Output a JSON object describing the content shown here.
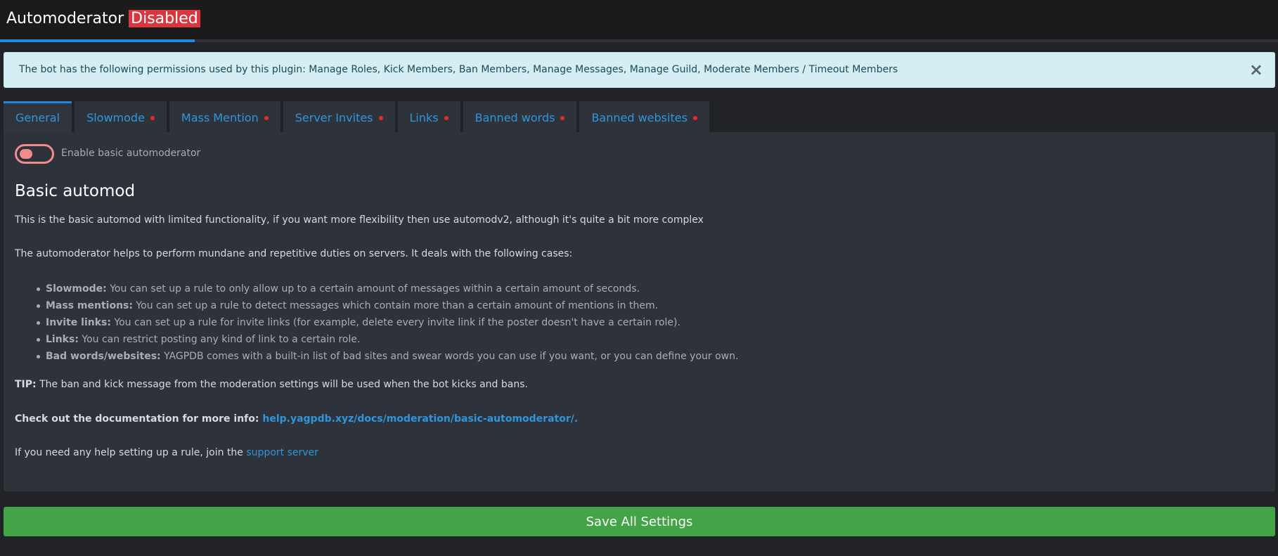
{
  "header": {
    "title": "Automoderator",
    "status": "Disabled"
  },
  "alert": {
    "text": "The bot has the following permissions used by this plugin: Manage Roles, Kick Members, Ban Members, Manage Messages, Manage Guild, Moderate Members / Timeout Members",
    "close_label": "×"
  },
  "tabs": [
    {
      "label": "General",
      "active": true,
      "dot": false
    },
    {
      "label": "Slowmode",
      "active": false,
      "dot": true
    },
    {
      "label": "Mass Mention",
      "active": false,
      "dot": true
    },
    {
      "label": "Server Invites",
      "active": false,
      "dot": true
    },
    {
      "label": "Links",
      "active": false,
      "dot": true
    },
    {
      "label": "Banned words",
      "active": false,
      "dot": true
    },
    {
      "label": "Banned websites",
      "active": false,
      "dot": true
    }
  ],
  "general": {
    "toggle_label": "Enable basic automoderator",
    "toggle_enabled": false,
    "title": "Basic automod",
    "intro": "This is the basic automod with limited functionality, if you want more flexibility then use automodv2, although it's quite a bit more complex",
    "cases_intro": "The automoderator helps to perform mundane and repetitive duties on servers. It deals with the following cases:",
    "cases": [
      {
        "term": "Slowmode:",
        "desc": " You can set up a rule to only allow up to a certain amount of messages within a certain amount of seconds."
      },
      {
        "term": "Mass mentions:",
        "desc": " You can set up a rule to detect messages which contain more than a certain amount of mentions in them."
      },
      {
        "term": "Invite links:",
        "desc": " You can set up a rule for invite links (for example, delete every invite link if the poster doesn't have a certain role)."
      },
      {
        "term": "Links:",
        "desc": " You can restrict posting any kind of link to a certain role."
      },
      {
        "term": "Bad words/websites:",
        "desc": " YAGPDB comes with a built-in list of bad sites and swear words you can use if you want, or you can define your own."
      }
    ],
    "tip_label": "TIP:",
    "tip_text": " The ban and kick message from the moderation settings will be used when the bot kicks and bans.",
    "docs_label": "Check out the documentation for more info: ",
    "docs_link": "help.yagpdb.xyz/docs/moderation/basic-automoderator/.",
    "help_text": "If you need any help setting up a rule, join the ",
    "help_link": "support server"
  },
  "save_label": "Save All Settings",
  "colors": {
    "accent": "#1e88e5",
    "disabled_badge": "#d9373f",
    "save": "#43a447",
    "tab_dot": "#ea2a2a"
  }
}
